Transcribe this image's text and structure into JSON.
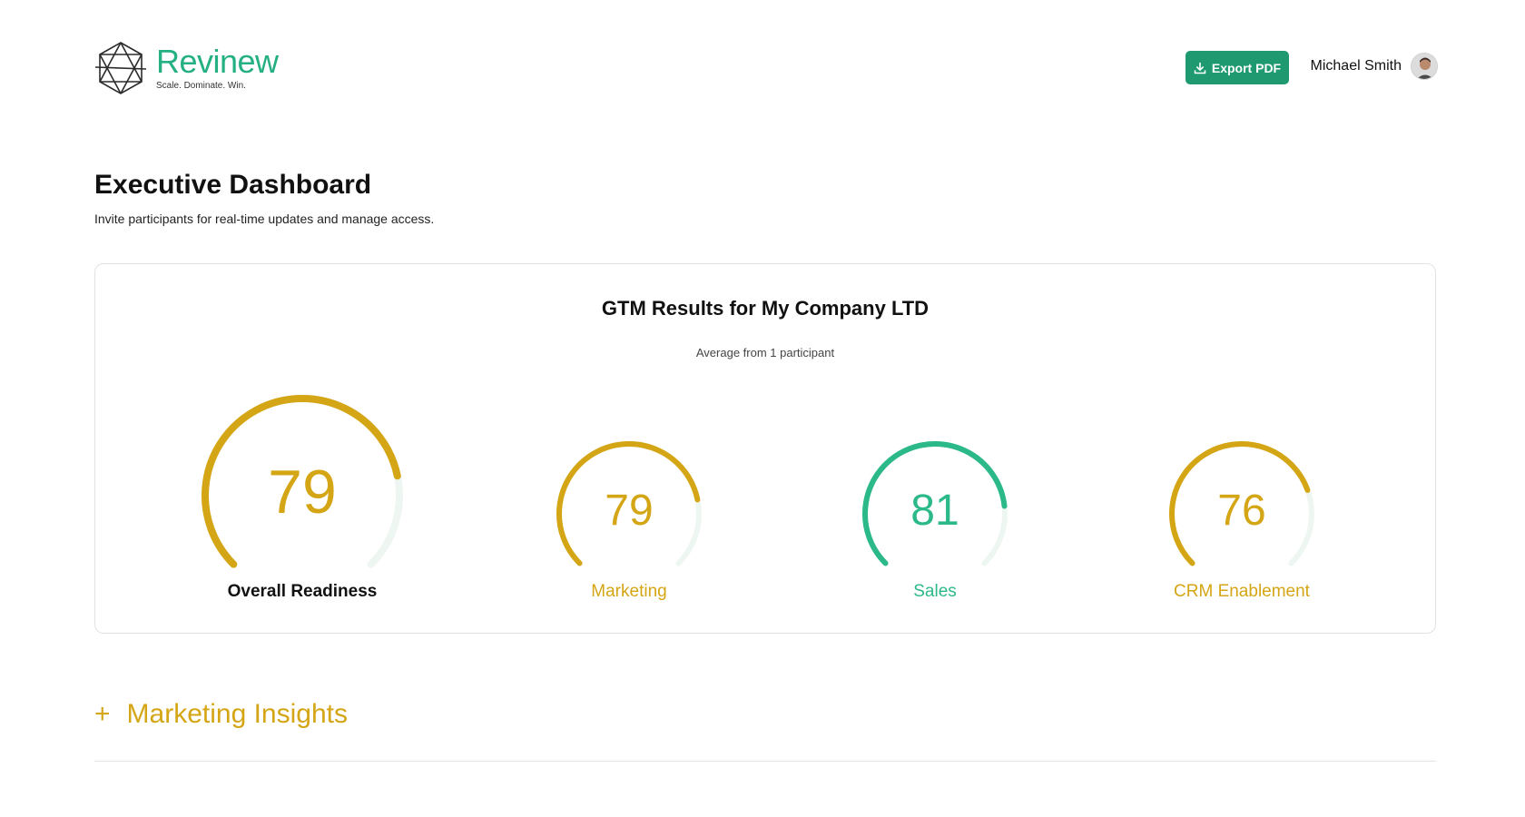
{
  "brand": {
    "name": "Revinew",
    "tagline": "Scale. Dominate. Win.",
    "color": "#24b083"
  },
  "header": {
    "export_label": "Export PDF",
    "export_icon": "download-icon",
    "user_name": "Michael Smith"
  },
  "page": {
    "title": "Executive Dashboard",
    "subtitle": "Invite participants for real-time updates and manage access."
  },
  "results": {
    "title": "GTM Results for My Company LTD",
    "subtitle": "Average from 1 participant",
    "gauges": [
      {
        "label": "Overall Readiness",
        "value": 79,
        "color": "#d4a514",
        "label_color": "#111111"
      },
      {
        "label": "Marketing",
        "value": 79,
        "color": "#d4a514",
        "label_color": "#d4a514"
      },
      {
        "label": "Sales",
        "value": 81,
        "color": "#2bb98a",
        "label_color": "#2bb98a"
      },
      {
        "label": "CRM Enablement",
        "value": 76,
        "color": "#d4a514",
        "label_color": "#d4a514"
      }
    ],
    "track_color": "#eef6f2"
  },
  "insights": {
    "label": "Marketing Insights",
    "icon": "plus-icon"
  }
}
